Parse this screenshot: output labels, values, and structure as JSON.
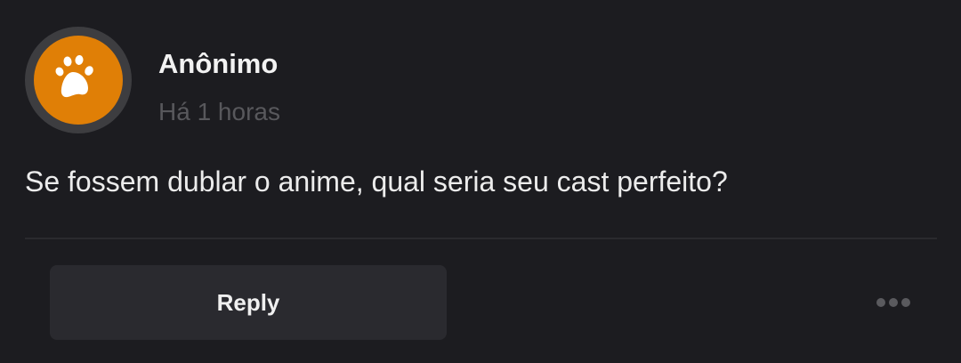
{
  "post": {
    "author": "Anônimo",
    "avatar_icon": "paw-icon",
    "avatar_color": "#e07f06",
    "timestamp": "Há 1 horas",
    "message": "Se fossem dublar o anime, qual seria seu cast perfeito?"
  },
  "actions": {
    "reply_label": "Reply",
    "more_icon": "more-horizontal-icon"
  }
}
